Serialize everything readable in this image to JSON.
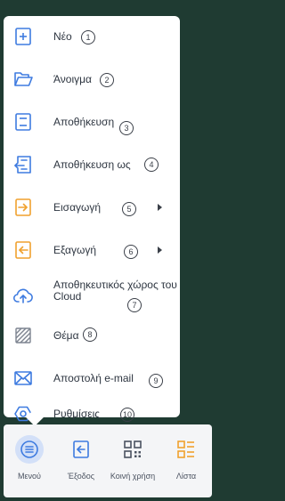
{
  "menu": {
    "items": [
      {
        "label": "Νέο",
        "number": "1",
        "icon": "new-file-icon"
      },
      {
        "label": "Άνοιγμα",
        "number": "2",
        "icon": "folder-open-icon"
      },
      {
        "label": "Αποθήκευση",
        "number": "3",
        "icon": "save-icon"
      },
      {
        "label": "Αποθήκευση ως",
        "number": "4",
        "icon": "save-as-icon"
      },
      {
        "label": "Εισαγωγή",
        "number": "5",
        "icon": "import-icon"
      },
      {
        "label": "Εξαγωγή",
        "number": "6",
        "icon": "export-icon"
      },
      {
        "label": "Αποθηκευτικός χώρος του Cloud",
        "number": "7",
        "icon": "cloud-upload-icon"
      },
      {
        "label": "Θέμα",
        "number": "8",
        "icon": "theme-icon"
      },
      {
        "label": "Αποστολή e-mail",
        "number": "9",
        "icon": "mail-icon"
      },
      {
        "label": "Ρυθμίσεις",
        "number": "10",
        "icon": "settings-icon"
      }
    ]
  },
  "bottom_bar": {
    "tabs": [
      {
        "label": "Μενού",
        "icon": "menu-icon",
        "active": true
      },
      {
        "label": "Έξοδος",
        "icon": "exit-icon",
        "active": false
      },
      {
        "label": "Κοινή χρήση",
        "icon": "qr-code-icon",
        "active": false
      },
      {
        "label": "Λίστα",
        "icon": "list-icon",
        "active": false
      }
    ]
  },
  "colors": {
    "blue_accent": "#3e7be0",
    "orange_accent": "#f0a12e",
    "background_dark": "#1f3b32",
    "panel": "#ffffff",
    "bottom_bar": "#f4f5f7"
  }
}
